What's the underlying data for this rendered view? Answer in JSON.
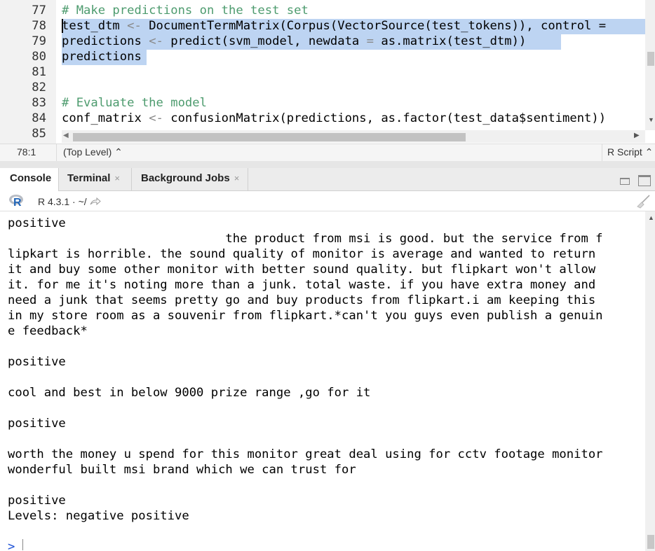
{
  "editor": {
    "line_numbers": [
      "77",
      "78",
      "79",
      "80",
      "81",
      "82",
      "83",
      "84",
      "85"
    ],
    "lines": [
      {
        "n": "77",
        "segments": [
          {
            "t": "# Make predictions on the test set",
            "c": "comment"
          }
        ]
      },
      {
        "n": "78",
        "segments": [
          {
            "t": "test_dtm ",
            "c": ""
          },
          {
            "t": "<-",
            "c": "op"
          },
          {
            "t": " DocumentTermMatrix(Corpus(VectorSource(test_tokens)), control =",
            "c": ""
          }
        ]
      },
      {
        "n": "79",
        "segments": [
          {
            "t": "predictions ",
            "c": ""
          },
          {
            "t": "<-",
            "c": "op"
          },
          {
            "t": " predict(svm_model, newdata ",
            "c": ""
          },
          {
            "t": "=",
            "c": "op"
          },
          {
            "t": " as.matrix(test_dtm))",
            "c": ""
          }
        ]
      },
      {
        "n": "80",
        "segments": [
          {
            "t": "predictions",
            "c": ""
          }
        ]
      },
      {
        "n": "81",
        "segments": []
      },
      {
        "n": "82",
        "segments": []
      },
      {
        "n": "83",
        "segments": [
          {
            "t": "# Evaluate the model",
            "c": "comment"
          }
        ]
      },
      {
        "n": "84",
        "segments": [
          {
            "t": "conf_matrix ",
            "c": ""
          },
          {
            "t": "<-",
            "c": "op"
          },
          {
            "t": " confusionMatrix(predictions, as.factor(test_data$sentiment))",
            "c": ""
          }
        ]
      },
      {
        "n": "85",
        "segments": []
      }
    ]
  },
  "status": {
    "position": "78:1",
    "scope": "(Top Level) ⌃",
    "file_type": "R Script ⌃"
  },
  "tabs": {
    "console": "Console",
    "terminal": "Terminal",
    "background_jobs": "Background Jobs",
    "close": "×"
  },
  "toolbar": {
    "r_version": "R 4.3.1 · ~/"
  },
  "console": {
    "lines": [
      "",
      "positive",
      "                              the product from msi is good. but the service from f",
      "lipkart is horrible. the sound quality of monitor is average and wanted to return",
      "it and buy some other monitor with better sound quality. but flipkart won't allow",
      "it. for me it's noting more than a junk. total waste. if you have extra money and",
      "need a junk that seems pretty go and buy products from flipkart.i am keeping this",
      "in my store room as a souvenir from flipkart.*can't you guys even publish a genuin",
      "e feedback*",
      "",
      "positive",
      "",
      "cool and best in below 9000 prize range ,go for it",
      "",
      "positive",
      "",
      "worth the money u spend for this monitor great deal using for cctv footage monitor",
      "wonderful built msi brand which we can trust for",
      "",
      "positive",
      "Levels: negative positive"
    ],
    "prompt": ">"
  },
  "colors": {
    "selection": "#bdd4f2",
    "comment": "#4d9b6e",
    "prompt": "#1a4fd6"
  }
}
